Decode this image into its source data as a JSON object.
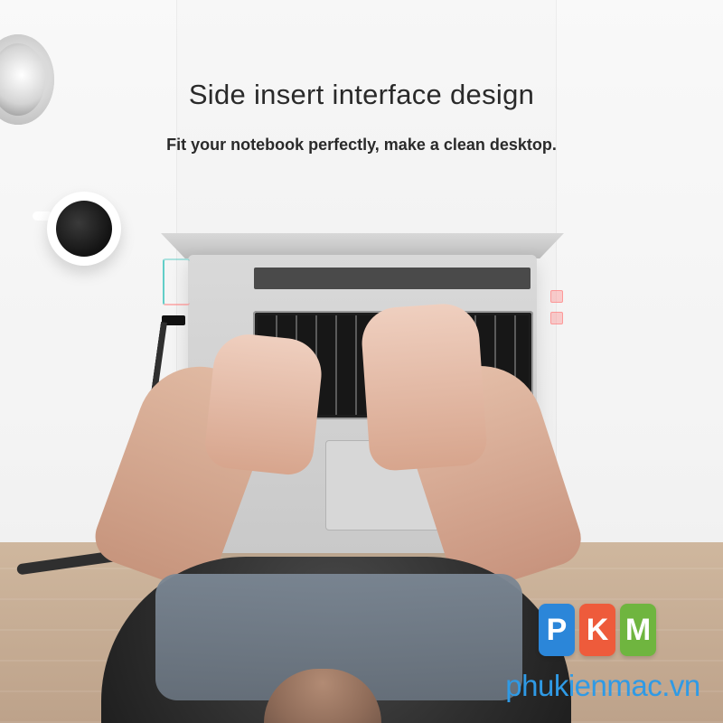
{
  "header": {
    "title": "Side insert interface design",
    "subtitle": "Fit your notebook perfectly, make a clean desktop."
  },
  "logo": {
    "letters": [
      "P",
      "K",
      "M"
    ],
    "site": "phukienmac.vn",
    "colors": [
      "#2b86d9",
      "#ee5b3b",
      "#6fb53f"
    ]
  }
}
